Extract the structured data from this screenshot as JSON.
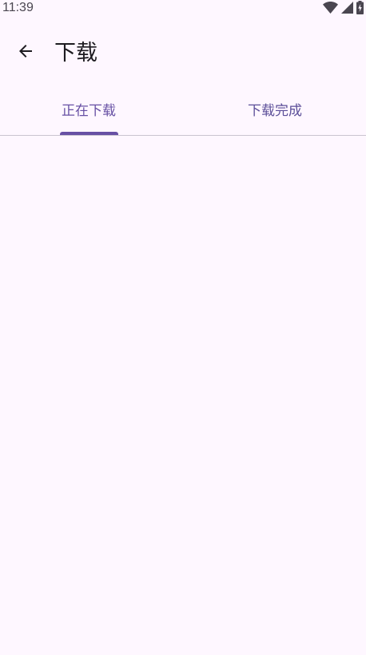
{
  "status_bar": {
    "time": "11:39",
    "icons": [
      "wifi-icon",
      "signal-icon",
      "battery-charging-icon"
    ]
  },
  "app_bar": {
    "back_icon": "arrow-left-icon",
    "title": "下载"
  },
  "tabs": [
    {
      "label": "正在下载",
      "selected": true
    },
    {
      "label": "下载完成",
      "selected": false
    }
  ],
  "colors": {
    "background": "#fef7ff",
    "primary": "#6750a4",
    "on_surface": "#1d1b20",
    "divider": "#cac4d0"
  }
}
